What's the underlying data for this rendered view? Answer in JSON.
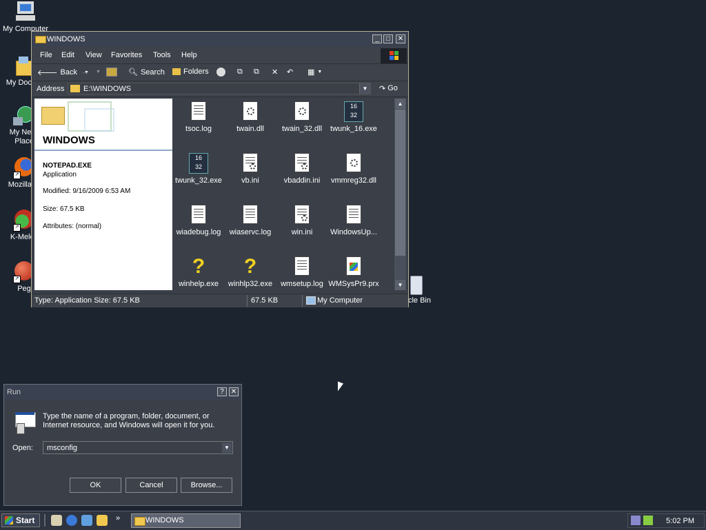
{
  "desktop": {
    "icons": [
      {
        "label": "My Computer",
        "icon": "computer-icon"
      },
      {
        "label": "My Docum",
        "icon": "folder-icon"
      },
      {
        "label": "My Netw",
        "label2": "Place",
        "icon": "network-icon"
      },
      {
        "label": "Mozilla Fi",
        "icon": "firefox-icon"
      },
      {
        "label": "K-Melec",
        "icon": "kmeleon-icon"
      },
      {
        "label": "Peg",
        "icon": "pegasus-icon"
      }
    ],
    "recycle_bin_label": "cle Bin"
  },
  "explorer": {
    "title": "WINDOWS",
    "menu": [
      "File",
      "Edit",
      "View",
      "Favorites",
      "Tools",
      "Help"
    ],
    "toolbar": {
      "back": "Back",
      "search": "Search",
      "folders": "Folders"
    },
    "address_label": "Address",
    "address_value": "E:\\WINDOWS",
    "go_label": "Go",
    "details": {
      "folder_title": "WINDOWS",
      "file_name": "NOTEPAD.EXE",
      "file_type": "Application",
      "modified": "Modified: 9/16/2009 6:53 AM",
      "size": "Size: 67.5 KB",
      "attributes": "Attributes: (normal)"
    },
    "files": [
      {
        "name": "tsoc.log",
        "kind": "doc"
      },
      {
        "name": "twain.dll",
        "kind": "dll"
      },
      {
        "name": "twain_32.dll",
        "kind": "dll"
      },
      {
        "name": "twunk_16.exe",
        "kind": "exe32"
      },
      {
        "name": "twunk_32.exe",
        "kind": "exe32"
      },
      {
        "name": "vb.ini",
        "kind": "ini"
      },
      {
        "name": "vbaddin.ini",
        "kind": "ini"
      },
      {
        "name": "vmmreg32.dll",
        "kind": "dll"
      },
      {
        "name": "wiadebug.log",
        "kind": "doc"
      },
      {
        "name": "wiaservc.log",
        "kind": "doc"
      },
      {
        "name": "win.ini",
        "kind": "ini"
      },
      {
        "name": "WindowsUp...",
        "kind": "doc"
      },
      {
        "name": "winhelp.exe",
        "kind": "help"
      },
      {
        "name": "winhlp32.exe",
        "kind": "help"
      },
      {
        "name": "wmsetup.log",
        "kind": "doc"
      },
      {
        "name": "WMSysPr9.prx",
        "kind": "prx"
      }
    ],
    "status": {
      "type": "Type: Application Size: 67.5 KB",
      "size": "67.5 KB",
      "location": "My Computer"
    }
  },
  "run_dialog": {
    "title": "Run",
    "description_line1": "Type the name of a program, folder, document, or",
    "description_line2": "Internet resource, and Windows will open it for you.",
    "open_label": "Open:",
    "open_value": "msconfig",
    "ok": "OK",
    "cancel": "Cancel",
    "browse": "Browse..."
  },
  "taskbar": {
    "start": "Start",
    "quicklaunch_more": "»",
    "task": "WINDOWS",
    "clock": "5:02 PM"
  }
}
